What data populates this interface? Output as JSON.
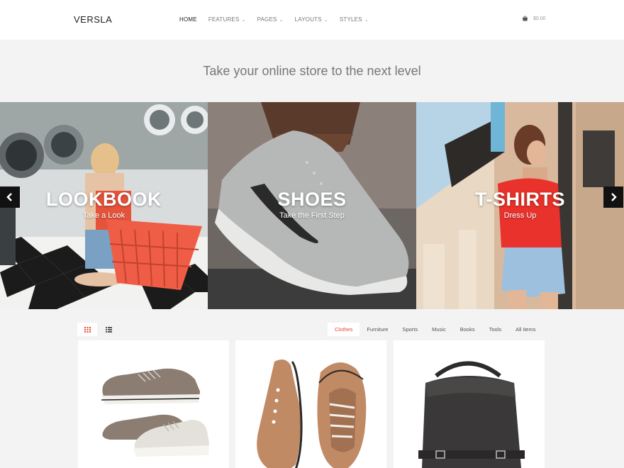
{
  "header": {
    "logo": "VERSLA",
    "nav": [
      {
        "label": "HOME",
        "has_dropdown": false,
        "active": true
      },
      {
        "label": "FEATURES",
        "has_dropdown": true,
        "active": false
      },
      {
        "label": "PAGES",
        "has_dropdown": true,
        "active": false
      },
      {
        "label": "LAYOUTS",
        "has_dropdown": true,
        "active": false
      },
      {
        "label": "STYLES",
        "has_dropdown": true,
        "active": false
      }
    ],
    "cart_total": "$0.00"
  },
  "tagline": "Take your online store to the next level",
  "slider": {
    "slides": [
      {
        "title": "LOOKBOOK",
        "subtitle": "Take a Look"
      },
      {
        "title": "SHOES",
        "subtitle": "Take the First Step"
      },
      {
        "title": "T-SHIRTS",
        "subtitle": "Dress Up"
      }
    ],
    "prev_icon": "chevron-left-icon",
    "next_icon": "chevron-right-icon"
  },
  "toolbar": {
    "views": [
      "grid-view-icon",
      "list-view-icon"
    ],
    "active_view": "grid",
    "filters": [
      "Clothes",
      "Furniture",
      "Sports",
      "Music",
      "Books",
      "Tools",
      "All items"
    ],
    "active_filter": "Clothes"
  },
  "products": [
    {
      "image": "sneakers-image"
    },
    {
      "image": "shoes-image"
    },
    {
      "image": "handbag-image"
    }
  ],
  "colors": {
    "accent": "#e8453c",
    "header_bg": "#ffffff",
    "page_bg": "#f3f3f3"
  }
}
